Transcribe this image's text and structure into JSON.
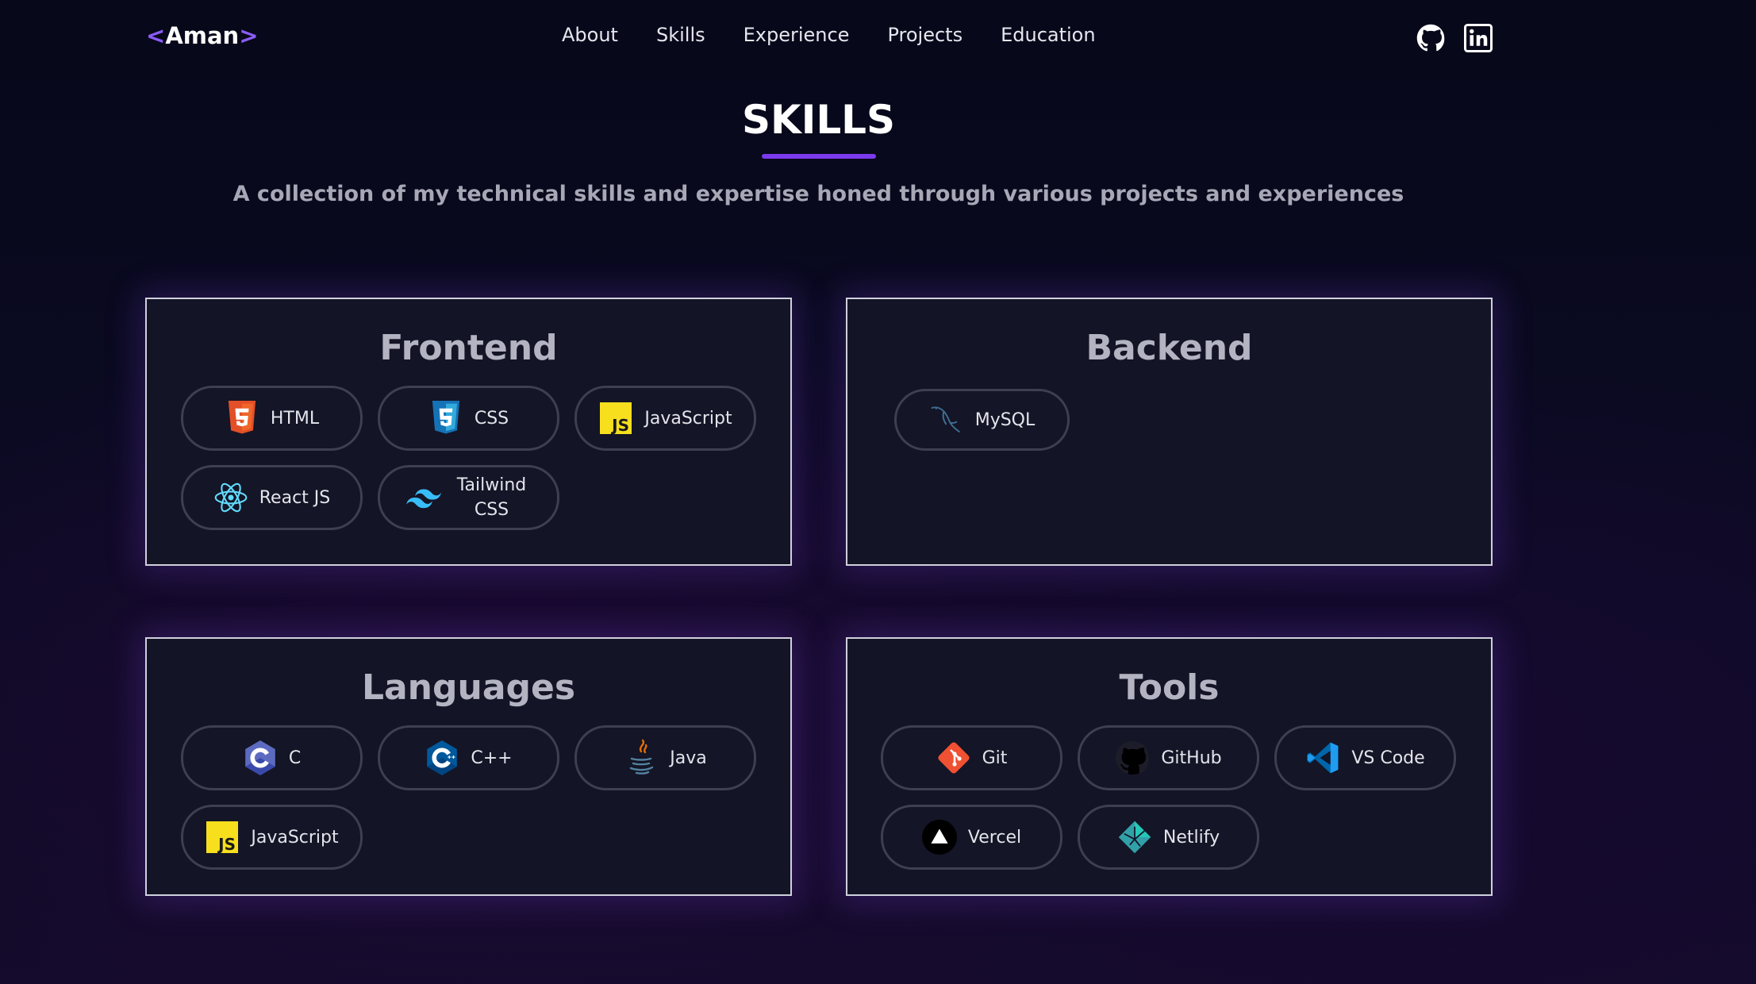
{
  "nav": {
    "logo": {
      "open": "<",
      "name": "Aman",
      "close": ">"
    },
    "links": [
      "About",
      "Skills",
      "Experience",
      "Projects",
      "Education"
    ],
    "social": [
      "github-icon",
      "linkedin-icon"
    ]
  },
  "header": {
    "title": "SKILLS",
    "subtitle": "A collection of my technical skills and expertise honed through various projects and experiences"
  },
  "categories": {
    "frontend": {
      "title": "Frontend",
      "skills": [
        {
          "label": "HTML",
          "icon": "html5-icon"
        },
        {
          "label": "CSS",
          "icon": "css3-icon"
        },
        {
          "label": "JavaScript",
          "icon": "javascript-icon"
        },
        {
          "label": "React JS",
          "icon": "react-icon"
        },
        {
          "label": "Tailwind CSS",
          "icon": "tailwind-icon"
        }
      ]
    },
    "backend": {
      "title": "Backend",
      "skills": [
        {
          "label": "MySQL",
          "icon": "mysql-icon"
        }
      ]
    },
    "languages": {
      "title": "Languages",
      "skills": [
        {
          "label": "C",
          "icon": "c-icon"
        },
        {
          "label": "C++",
          "icon": "cpp-icon"
        },
        {
          "label": "Java",
          "icon": "java-icon"
        },
        {
          "label": "JavaScript",
          "icon": "javascript-icon"
        }
      ]
    },
    "tools": {
      "title": "Tools",
      "skills": [
        {
          "label": "Git",
          "icon": "git-icon"
        },
        {
          "label": "GitHub",
          "icon": "github-icon"
        },
        {
          "label": "VS Code",
          "icon": "vscode-icon"
        },
        {
          "label": "Vercel",
          "icon": "vercel-icon"
        },
        {
          "label": "Netlify",
          "icon": "netlify-icon"
        }
      ]
    }
  },
  "colors": {
    "accent": "#7c3aed",
    "background": "#0b0a22",
    "card": "#131426"
  }
}
